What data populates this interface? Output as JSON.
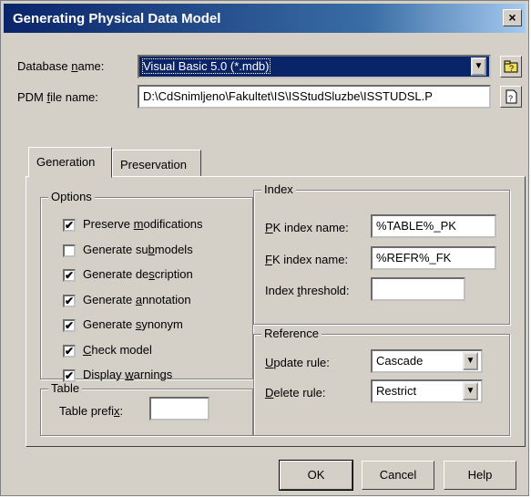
{
  "window": {
    "title": "Generating Physical Data Model",
    "close_glyph": "×"
  },
  "fields": {
    "database_label_pre": "Database ",
    "database_label_u": "n",
    "database_label_post": "ame:",
    "database_value": "Visual Basic 5.0 (*.mdb)",
    "pdm_label_pre": "PDM ",
    "pdm_label_u": "f",
    "pdm_label_post": "ile name:",
    "pdm_value": "D:\\CdSnimljeno\\Fakultet\\IS\\ISStudSluzbe\\ISSTUDSL.P"
  },
  "tabs": [
    {
      "label": "Generation",
      "active": true
    },
    {
      "label": "Preservation",
      "active": false
    }
  ],
  "options": {
    "legend": "Options",
    "items": [
      {
        "pre": "Preserve ",
        "u": "m",
        "post": "odifications",
        "checked": true
      },
      {
        "pre": "Generate su",
        "u": "b",
        "post": "models",
        "checked": false
      },
      {
        "pre": "Generate de",
        "u": "s",
        "post": "cription",
        "checked": true
      },
      {
        "pre": "Generate ",
        "u": "a",
        "post": "nnotation",
        "checked": true
      },
      {
        "pre": "Generate ",
        "u": "s",
        "post": "ynonym",
        "checked": true
      },
      {
        "pre": "",
        "u": "C",
        "post": "heck model",
        "checked": true
      },
      {
        "pre": "Display ",
        "u": "w",
        "post": "arnings",
        "checked": true
      }
    ]
  },
  "table_group": {
    "legend": "Table",
    "prefix_pre": "Table prefi",
    "prefix_u": "x",
    "prefix_post": ":",
    "prefix_value": ""
  },
  "index_group": {
    "legend": "Index",
    "pk_u": "P",
    "pk_post": "K index name:",
    "pk_value": "%TABLE%_PK",
    "fk_u": "F",
    "fk_post": "K index name:",
    "fk_value": "%REFR%_FK",
    "thr_pre": "Index ",
    "thr_u": "t",
    "thr_post": "hreshold:",
    "thr_value": ""
  },
  "reference_group": {
    "legend": "Reference",
    "update_u": "U",
    "update_post": "pdate rule:",
    "update_value": "Cascade",
    "delete_u": "D",
    "delete_post": "elete rule:",
    "delete_value": "Restrict"
  },
  "buttons": {
    "ok": "OK",
    "cancel": "Cancel",
    "help": "Help"
  },
  "icons": {
    "browse_db": "folder-icon",
    "browse_pdm": "file-icon",
    "dropdown": "chevron-down-icon",
    "checkmark": "✔"
  }
}
